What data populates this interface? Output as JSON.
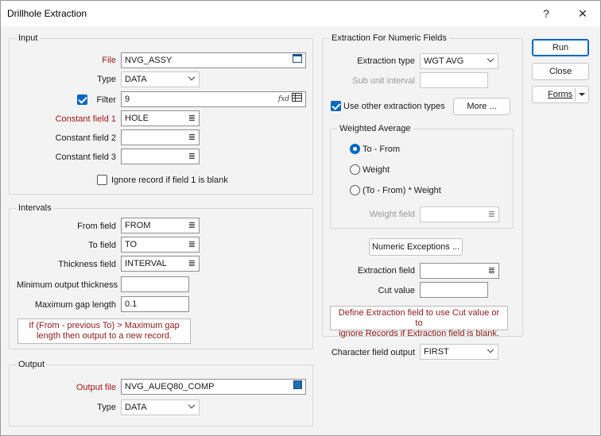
{
  "window": {
    "title": "Drillhole Extraction",
    "help": "?",
    "close": "✕"
  },
  "input": {
    "title": "Input",
    "file_label": "File",
    "file_value": "NVG_ASSY",
    "type_label": "Type",
    "type_value": "DATA",
    "filter_label": "Filter",
    "filter_value": "9",
    "filter_checked": true,
    "const1_label": "Constant field 1",
    "const1_value": "HOLE",
    "const2_label": "Constant field 2",
    "const2_value": "",
    "const3_label": "Constant field 3",
    "const3_value": "",
    "ignore_label": "Ignore record if field 1 is blank"
  },
  "intervals": {
    "title": "Intervals",
    "from_label": "From field",
    "from_value": "FROM",
    "to_label": "To field",
    "to_value": "TO",
    "thick_label": "Thickness field",
    "thick_value": "INTERVAL",
    "min_label": "Minimum output thickness",
    "min_value": "",
    "gap_label": "Maximum gap length",
    "gap_value": "0.1",
    "note_line1": "If (From - previous To) > Maximum gap",
    "note_line2": "length then output to a new record."
  },
  "output": {
    "title": "Output",
    "file_label": "Output file",
    "file_value": "NVG_AUEQ80_COMP",
    "type_label": "Type",
    "type_value": "DATA"
  },
  "numeric": {
    "title": "Extraction For Numeric Fields",
    "type_label": "Extraction type",
    "type_value": "WGT AVG",
    "sub_label": "Sub unit interval",
    "sub_value": "",
    "use_other_label": "Use other extraction types",
    "more_label": "More ...",
    "weighted": {
      "title": "Weighted Average",
      "opt1": "To - From",
      "opt2": "Weight",
      "opt3": "(To - From) * Weight",
      "weight_field_label": "Weight field",
      "weight_field_value": ""
    },
    "exceptions_label": "Numeric Exceptions ...",
    "extraction_field_label": "Extraction field",
    "extraction_field_value": "",
    "cut_label": "Cut value",
    "cut_value": "",
    "note_line1": "Define Extraction field to use Cut value or to",
    "note_line2": "ignore Records if Extraction field is blank."
  },
  "char": {
    "label": "Character field output",
    "value": "FIRST"
  },
  "actions": {
    "run": "Run",
    "close": "Close",
    "forms": "Forms"
  },
  "icons": {
    "calendar": "▭",
    "fx": "fxd",
    "list": "≣"
  },
  "colors": {
    "accent": "#0067c0",
    "required_label": "#a01818"
  }
}
